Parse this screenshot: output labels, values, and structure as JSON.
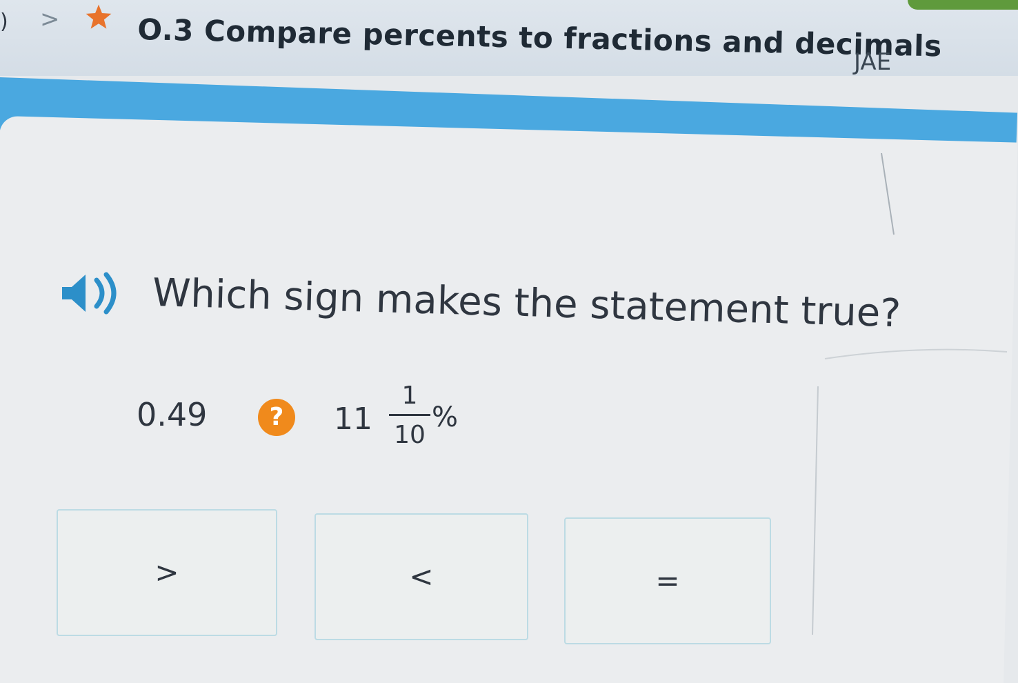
{
  "header": {
    "skill_title": "O.3 Compare percents to fractions and decimals",
    "user_tag": "JAE",
    "nav_chevron": ">",
    "left_glyph": ")"
  },
  "question": {
    "prompt": "Which sign makes the statement true?",
    "left_value": "0.49",
    "unknown_sign": "?",
    "right_whole": "11",
    "right_numerator": "1",
    "right_denominator": "10",
    "right_suffix": "%"
  },
  "choices": [
    {
      "label": ">"
    },
    {
      "label": "<"
    },
    {
      "label": "="
    }
  ],
  "colors": {
    "star": "#e8732c",
    "question_badge": "#f08a1c",
    "progress_band": "#4aa8e0",
    "choice_border": "#bcdbe4",
    "header_green": "#5f9a3c"
  },
  "icons": {
    "star": "star-icon",
    "speaker": "speaker-icon",
    "chevron": "chevron-right-icon"
  }
}
